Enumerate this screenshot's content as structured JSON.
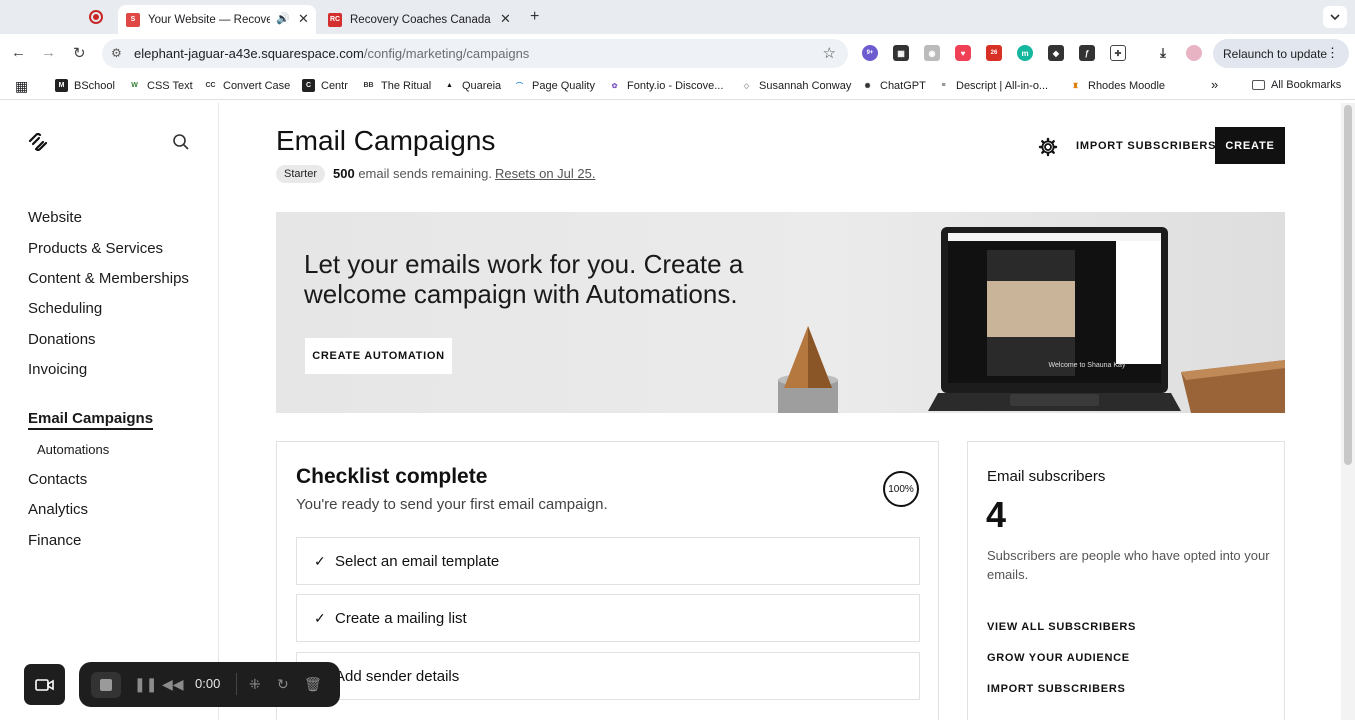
{
  "browser": {
    "tabs": [
      {
        "title": "Your Website — Recovery",
        "active": true
      },
      {
        "title": "Recovery Coaches Canada",
        "active": false
      }
    ],
    "url_host": "elephant-jaguar-a43e.squarespace.com",
    "url_path": "/config/marketing/campaigns",
    "extension_badge_1": "9+",
    "extension_badge_2": "26",
    "relaunch_label": "Relaunch to update",
    "bookmarks": [
      "BSchool",
      "CSS Text",
      "Convert Case",
      "Centr",
      "The Ritual",
      "Quareia",
      "Page Quality",
      "Fonty.io - Discove...",
      "Susannah Conway",
      "ChatGPT",
      "Descript | All-in-o...",
      "Rhodes Moodle"
    ],
    "all_bookmarks_label": "All Bookmarks",
    "colors": {
      "tabstrip": "#e8ebf0",
      "record_red": "#c62828"
    }
  },
  "sidebar": {
    "items": [
      {
        "label": "Website"
      },
      {
        "label": "Products & Services"
      },
      {
        "label": "Content & Memberships"
      },
      {
        "label": "Scheduling"
      },
      {
        "label": "Donations"
      },
      {
        "label": "Invoicing"
      }
    ],
    "active_item": "Email Campaigns",
    "sub_item": "Automations",
    "items_after": [
      {
        "label": "Contacts"
      },
      {
        "label": "Analytics"
      },
      {
        "label": "Finance"
      }
    ]
  },
  "header": {
    "title": "Email Campaigns",
    "plan_badge": "Starter",
    "sends_count": "500",
    "sends_text": "email sends remaining.",
    "reset_text": "Resets on Jul 25.",
    "import_label": "IMPORT SUBSCRIBERS",
    "create_label": "CREATE"
  },
  "banner": {
    "headline": "Let your emails work for you. Create a welcome campaign with Automations.",
    "button_label": "CREATE AUTOMATION",
    "screen_text": "Welcome to Shauna Kay"
  },
  "checklist": {
    "title": "Checklist complete",
    "subtitle": "You're ready to send your first email campaign.",
    "progress": "100%",
    "items": [
      {
        "label": "Select an email template",
        "done": true
      },
      {
        "label": "Create a mailing list",
        "done": true
      },
      {
        "label": "Add sender details",
        "done": true
      }
    ]
  },
  "subscribers": {
    "title": "Email subscribers",
    "count": "4",
    "description": "Subscribers are people who have opted into your emails.",
    "links": [
      "VIEW ALL SUBSCRIBERS",
      "GROW YOUR AUDIENCE",
      "IMPORT SUBSCRIBERS"
    ]
  },
  "recorder": {
    "time": "0:00"
  }
}
